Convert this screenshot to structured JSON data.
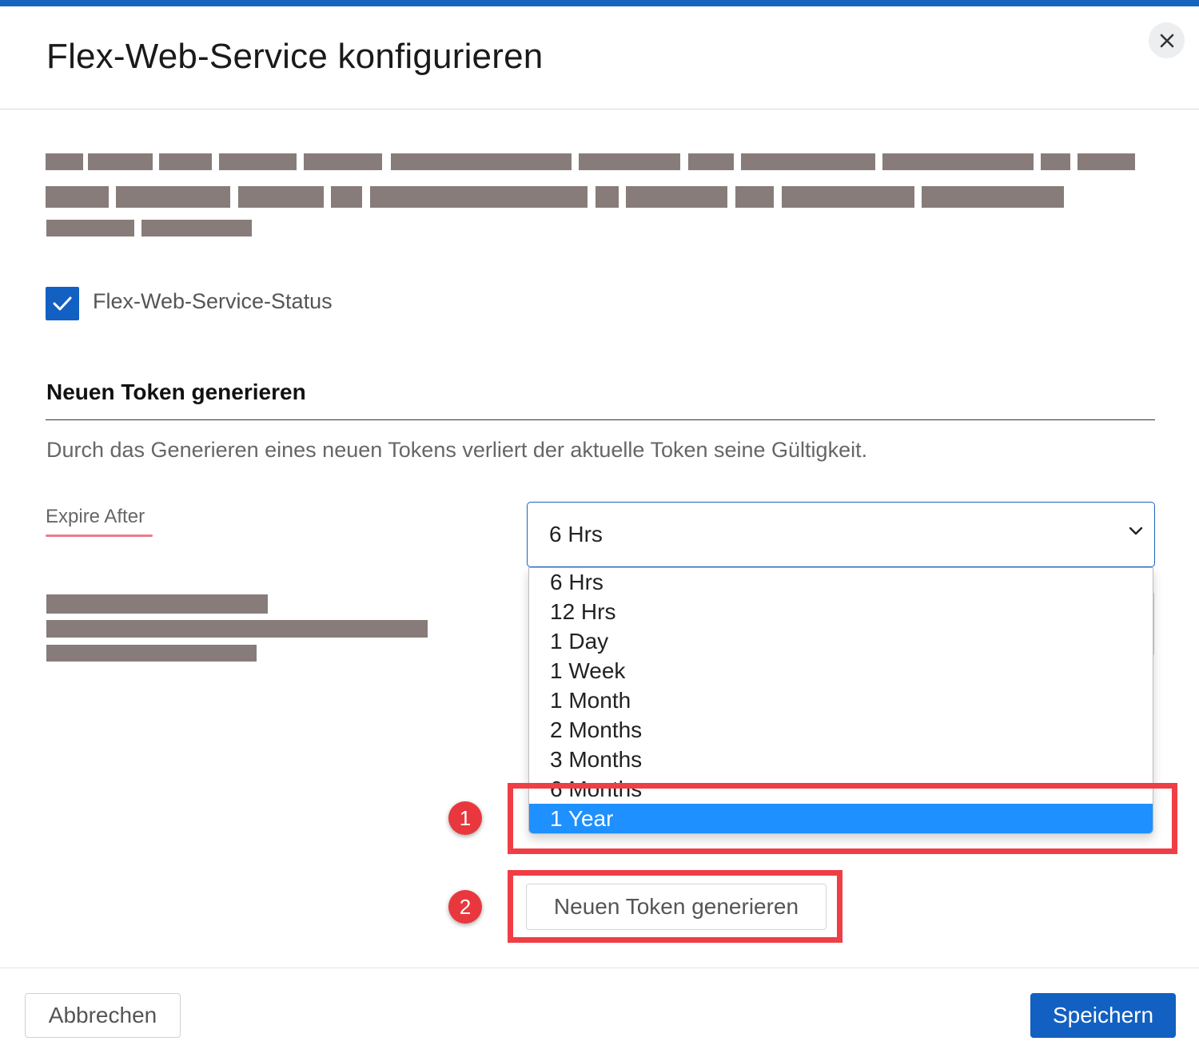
{
  "dialog": {
    "title": "Flex-Web-Service konfigurieren",
    "close_icon": "close-icon"
  },
  "status_checkbox": {
    "label": "Flex-Web-Service-Status",
    "checked": true
  },
  "token_section": {
    "heading": "Neuen Token generieren",
    "description": "Durch das Generieren eines neuen Tokens verliert der aktuelle Token seine Gültigkeit.",
    "expire_label": "Expire After",
    "expire_selected": "6 Hrs",
    "expire_options": [
      "6 Hrs",
      "12 Hrs",
      "1 Day",
      "1 Week",
      "1 Month",
      "2 Months",
      "3 Months",
      "6 Months",
      "1 Year"
    ],
    "highlighted_option": "1 Year",
    "generate_button": "Neuen Token generieren"
  },
  "annotations": {
    "badge_1": "1",
    "badge_2": "2",
    "highlight_color": "#ef3e45"
  },
  "footer": {
    "cancel_label": "Abbrechen",
    "save_label": "Speichern"
  },
  "colors": {
    "accent": "#1260c2",
    "top_bar": "#1565c0",
    "option_highlight": "#1e90ff",
    "redaction": "#877c79"
  }
}
